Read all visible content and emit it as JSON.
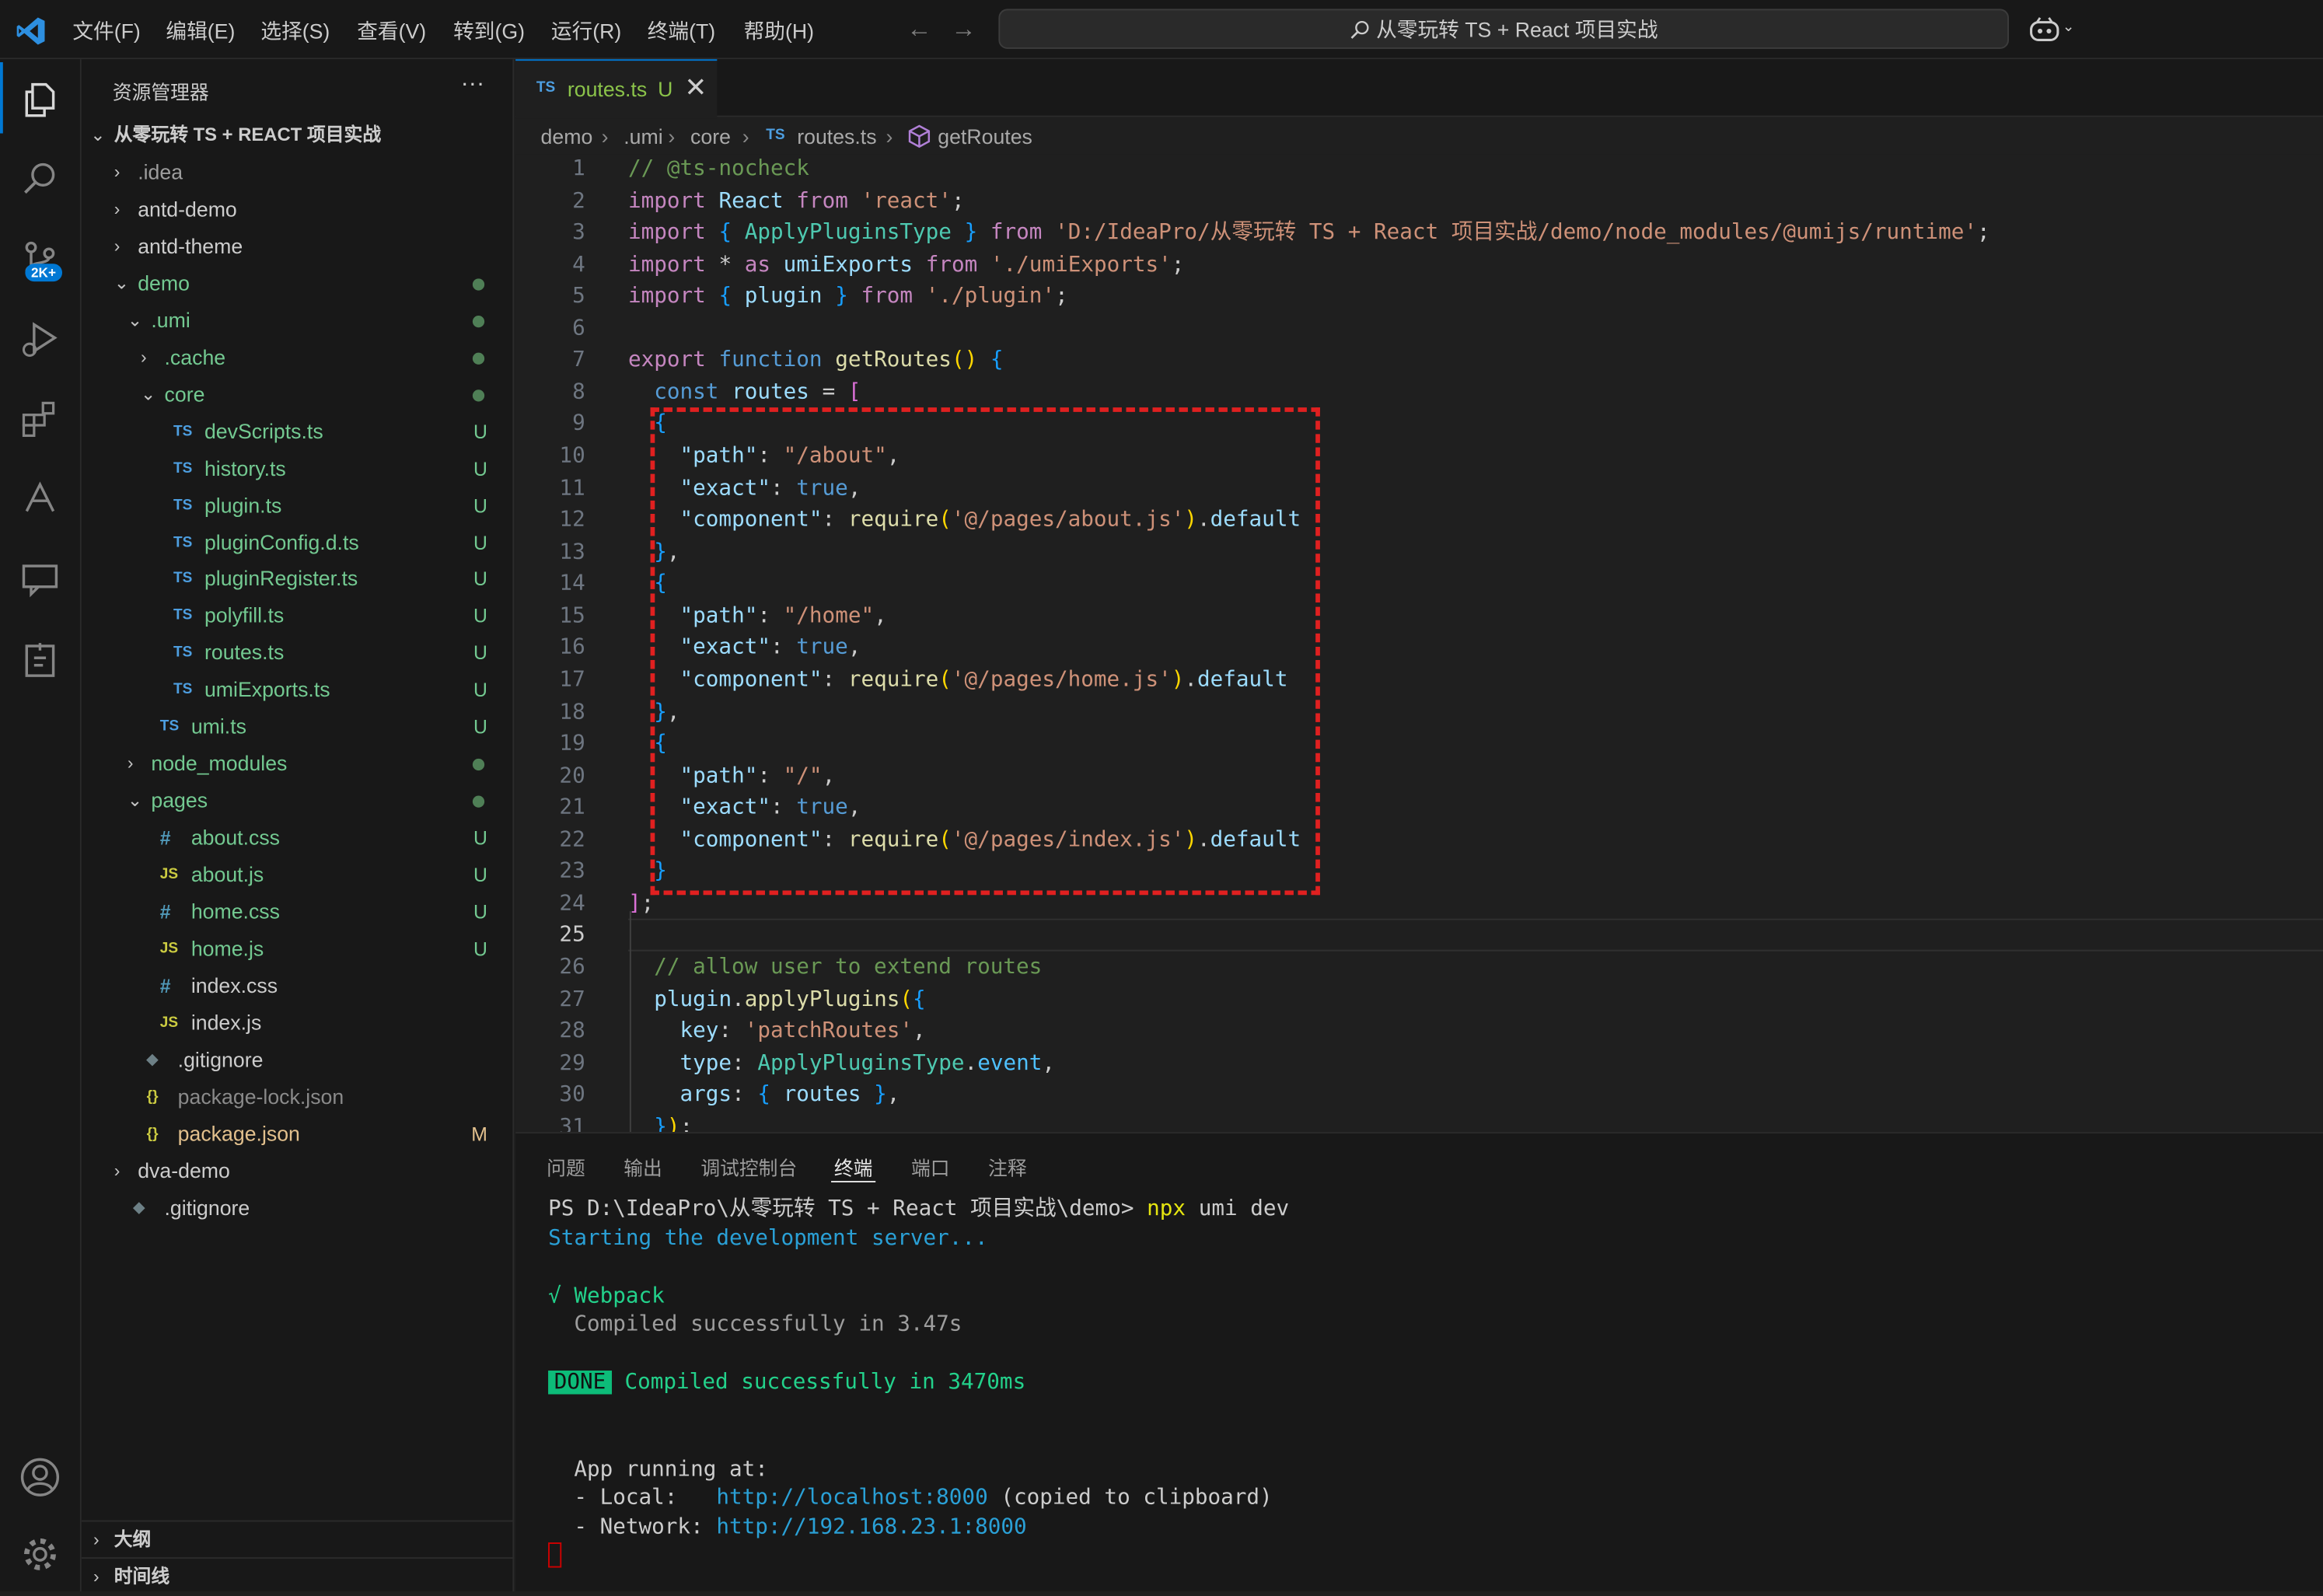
{
  "titlebar": {
    "menus": [
      "文件(F)",
      "编辑(E)",
      "选择(S)",
      "查看(V)",
      "转到(G)",
      "运行(R)",
      "终端(T)",
      "帮助(H)"
    ],
    "search_text": "从零玩转 TS + React 项目实战"
  },
  "activity": {
    "scm_badge": "2K+"
  },
  "explorer": {
    "title": "资源管理器",
    "more": "···",
    "root": "从零玩转 TS + REACT 项目实战",
    "items": [
      {
        "label": ".idea",
        "icon": "",
        "badge": ""
      },
      {
        "label": "antd-demo",
        "icon": "",
        "badge": ""
      },
      {
        "label": "antd-theme",
        "icon": "",
        "badge": ""
      },
      {
        "label": "demo",
        "icon": "",
        "badge": ""
      },
      {
        "label": ".umi",
        "icon": "",
        "badge": ""
      },
      {
        "label": ".cache",
        "icon": "",
        "badge": ""
      },
      {
        "label": "core",
        "icon": "",
        "badge": ""
      },
      {
        "label": "devScripts.ts",
        "icon": "TS",
        "badge": "U"
      },
      {
        "label": "history.ts",
        "icon": "TS",
        "badge": "U"
      },
      {
        "label": "plugin.ts",
        "icon": "TS",
        "badge": "U"
      },
      {
        "label": "pluginConfig.d.ts",
        "icon": "TS",
        "badge": "U"
      },
      {
        "label": "pluginRegister.ts",
        "icon": "TS",
        "badge": "U"
      },
      {
        "label": "polyfill.ts",
        "icon": "TS",
        "badge": "U"
      },
      {
        "label": "routes.ts",
        "icon": "TS",
        "badge": "U"
      },
      {
        "label": "umiExports.ts",
        "icon": "TS",
        "badge": "U"
      },
      {
        "label": "umi.ts",
        "icon": "TS",
        "badge": "U"
      },
      {
        "label": "node_modules",
        "icon": "",
        "badge": ""
      },
      {
        "label": "pages",
        "icon": "",
        "badge": ""
      },
      {
        "label": "about.css",
        "icon": "#",
        "badge": "U"
      },
      {
        "label": "about.js",
        "icon": "JS",
        "badge": "U"
      },
      {
        "label": "home.css",
        "icon": "#",
        "badge": "U"
      },
      {
        "label": "home.js",
        "icon": "JS",
        "badge": "U"
      },
      {
        "label": "index.css",
        "icon": "#",
        "badge": ""
      },
      {
        "label": "index.js",
        "icon": "JS",
        "badge": ""
      },
      {
        "label": ".gitignore",
        "icon": "◆",
        "badge": ""
      },
      {
        "label": "package-lock.json",
        "icon": "{}",
        "badge": ""
      },
      {
        "label": "package.json",
        "icon": "{}",
        "badge": "M"
      },
      {
        "label": "dva-demo",
        "icon": "",
        "badge": ""
      },
      {
        "label": ".gitignore",
        "icon": "◆",
        "badge": ""
      }
    ],
    "outline": "大纲",
    "timeline": "时间线"
  },
  "editor": {
    "tab": {
      "icon": "TS",
      "name": "routes.ts",
      "status": "U"
    },
    "breadcrumb": [
      "demo",
      ".umi",
      "core",
      "routes.ts",
      "getRoutes"
    ],
    "breadcrumb_icon": "TS",
    "line_numbers": [
      "1",
      "2",
      "3",
      "4",
      "5",
      "6",
      "7",
      "8",
      "9",
      "10",
      "11",
      "12",
      "13",
      "14",
      "15",
      "16",
      "17",
      "18",
      "19",
      "20",
      "21",
      "22",
      "23",
      "24",
      "25",
      "26",
      "27",
      "28",
      "29",
      "30",
      "31"
    ],
    "current_line": "25",
    "code": [
      "// @ts-nocheck",
      "import React from 'react';",
      "import { ApplyPluginsType } from 'D:/IdeaPro/从零玩转 TS + React 项目实战/demo/node_modules/@umijs/runtime';",
      "import * as umiExports from './umiExports';",
      "import { plugin } from './plugin';",
      "",
      "export function getRoutes() {",
      "  const routes = [",
      "  {",
      "    \"path\": \"/about\",",
      "    \"exact\": true,",
      "    \"component\": require('@/pages/about.js').default",
      "  },",
      "  {",
      "    \"path\": \"/home\",",
      "    \"exact\": true,",
      "    \"component\": require('@/pages/home.js').default",
      "  },",
      "  {",
      "    \"path\": \"/\",",
      "    \"exact\": true,",
      "    \"component\": require('@/pages/index.js').default",
      "  }",
      "];",
      "",
      "  // allow user to extend routes",
      "  plugin.applyPlugins({",
      "    key: 'patchRoutes',",
      "    type: ApplyPluginsType.event,",
      "    args: { routes },",
      "  });"
    ]
  },
  "panel": {
    "tabs": [
      "问题",
      "输出",
      "调试控制台",
      "终端",
      "端口",
      "注释"
    ],
    "active_tab": "终端",
    "terminal": {
      "prompt": "PS D:\\IdeaPro\\从零玩转 TS + React 项目实战\\demo> ",
      "cmd_npx": "npx",
      "cmd_rest": " umi dev",
      "starting": "Starting the development server...",
      "webpack": "√ Webpack",
      "compiled": "  Compiled successfully in 3.47s",
      "done_badge": "DONE",
      "done_text": " Compiled successfully in 3470ms",
      "app_running": "  App running at:",
      "local_label": "  - Local:   ",
      "local_url": "http://localhost:8000",
      "local_note": " (copied to clipboard)",
      "network_label": "  - Network: ",
      "network_url": "http://192.168.23.1:8000"
    }
  }
}
